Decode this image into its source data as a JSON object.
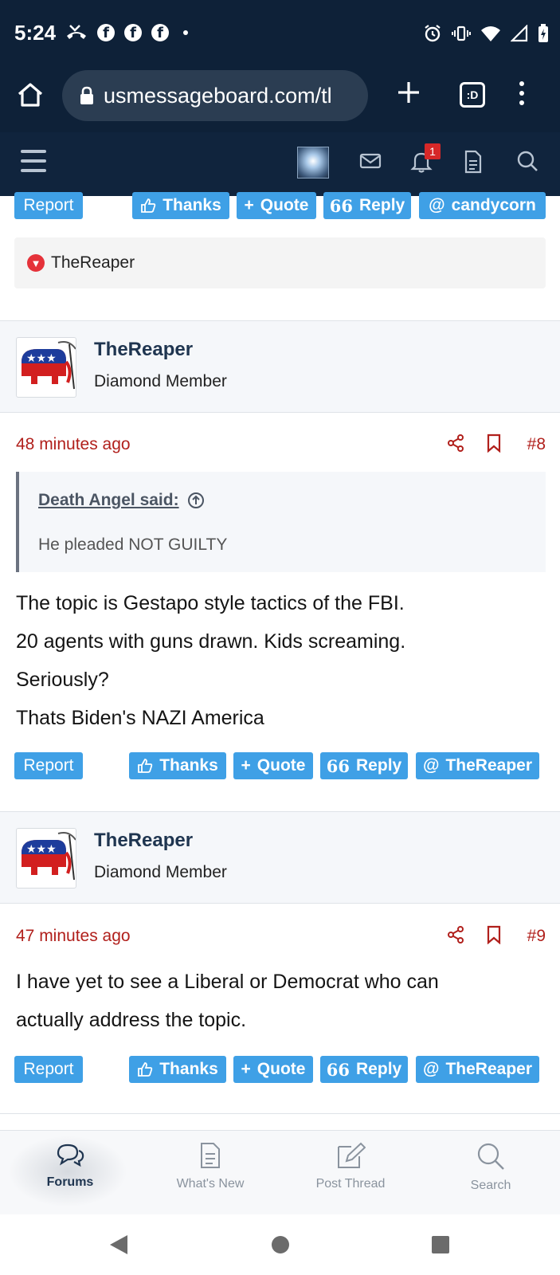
{
  "status_bar": {
    "time": "5:24"
  },
  "browser": {
    "url": "usmessageboard.com/tl",
    "tab_count": ":D"
  },
  "site_nav": {
    "alerts_badge": "1"
  },
  "post7_actions": {
    "report": "Report",
    "thanks": "Thanks",
    "quote": "Quote",
    "reply": "Reply",
    "mention": "candycorn"
  },
  "reaction": {
    "user": "TheReaper"
  },
  "posts": [
    {
      "author": "TheReaper",
      "user_title": "Diamond Member",
      "time": "48 minutes ago",
      "number": "#8",
      "quote": {
        "author_said": "Death Angel said:",
        "text": "He pleaded NOT GUILTY"
      },
      "lines": [
        "The topic is Gestapo style tactics of the FBI.",
        "20 agents with guns drawn. Kids screaming.",
        "Seriously?",
        "Thats Biden's NAZI America"
      ],
      "actions": {
        "report": "Report",
        "thanks": "Thanks",
        "quote": "Quote",
        "reply": "Reply",
        "mention": "TheReaper"
      }
    },
    {
      "author": "TheReaper",
      "user_title": "Diamond Member",
      "time": "47 minutes ago",
      "number": "#9",
      "lines": [
        "I have yet to see a Liberal or Democrat who can",
        "actually address the topic."
      ],
      "actions": {
        "report": "Report",
        "thanks": "Thanks",
        "quote": "Quote",
        "reply": "Reply",
        "mention": "TheReaper"
      }
    }
  ],
  "bottom_nav": [
    {
      "label": "Forums",
      "icon": "forums-icon",
      "active": true
    },
    {
      "label": "What's New",
      "icon": "whats-new-icon",
      "active": false
    },
    {
      "label": "Post Thread",
      "icon": "post-thread-icon",
      "active": false
    },
    {
      "label": "Search",
      "icon": "search-icon",
      "active": false
    }
  ],
  "colors": {
    "accent": "#3fa0e6",
    "header": "#0e2138",
    "time_red": "#b1201c",
    "username": "#1f3550"
  }
}
